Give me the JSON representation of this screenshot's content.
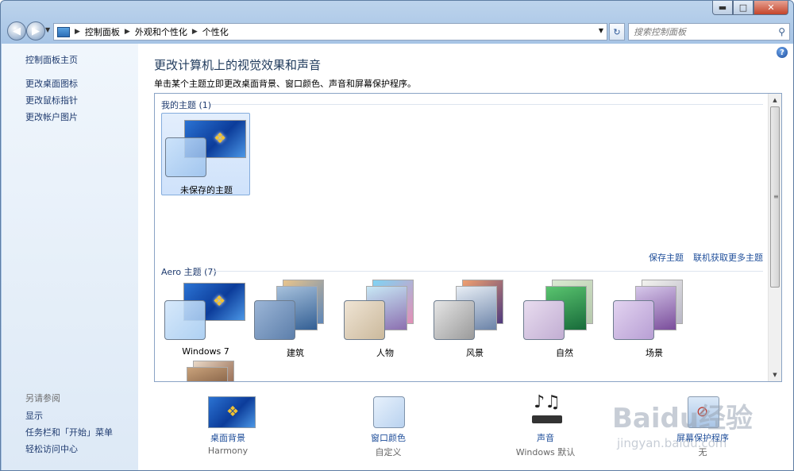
{
  "window": {
    "caption": {
      "min_icon": "minimize-icon",
      "max_icon": "maximize-icon",
      "close_icon": "close-icon"
    }
  },
  "address_bar": {
    "crumbs": [
      "控制面板",
      "外观和个性化",
      "个性化"
    ]
  },
  "search": {
    "placeholder": "搜索控制面板"
  },
  "left_pane": {
    "links": [
      "控制面板主页",
      "更改桌面图标",
      "更改鼠标指针",
      "更改帐户图片"
    ],
    "see_also_title": "另请参阅",
    "see_also": [
      "显示",
      "任务栏和「开始」菜单",
      "轻松访问中心"
    ]
  },
  "main": {
    "title": "更改计算机上的视觉效果和声音",
    "subtitle": "单击某个主题立即更改桌面背景、窗口颜色、声音和屏幕保护程序。",
    "my_themes_header": "我的主题 (1)",
    "my_themes": [
      {
        "name": "未保存的主题"
      }
    ],
    "save_theme": "保存主题",
    "get_more": "联机获取更多主题",
    "aero_header": "Aero 主题 (7)",
    "aero_themes": [
      {
        "name": "Windows 7"
      },
      {
        "name": "建筑"
      },
      {
        "name": "人物"
      },
      {
        "name": "风景"
      },
      {
        "name": "自然"
      },
      {
        "name": "场景"
      }
    ]
  },
  "bottom": {
    "desktop_bg": {
      "label": "桌面背景",
      "value": "Harmony"
    },
    "window_color": {
      "label": "窗口颜色",
      "value": "自定义"
    },
    "sounds": {
      "label": "声音",
      "value": "Windows 默认"
    },
    "screensaver": {
      "label": "屏幕保护程序",
      "value": "无"
    }
  },
  "watermark": {
    "text1": "Baidu经验",
    "text2": "jingyan.baidu.com"
  },
  "colors": {
    "accent": "#1f4e9a",
    "title": "#1e395b",
    "frame": "#a4c2e4"
  }
}
